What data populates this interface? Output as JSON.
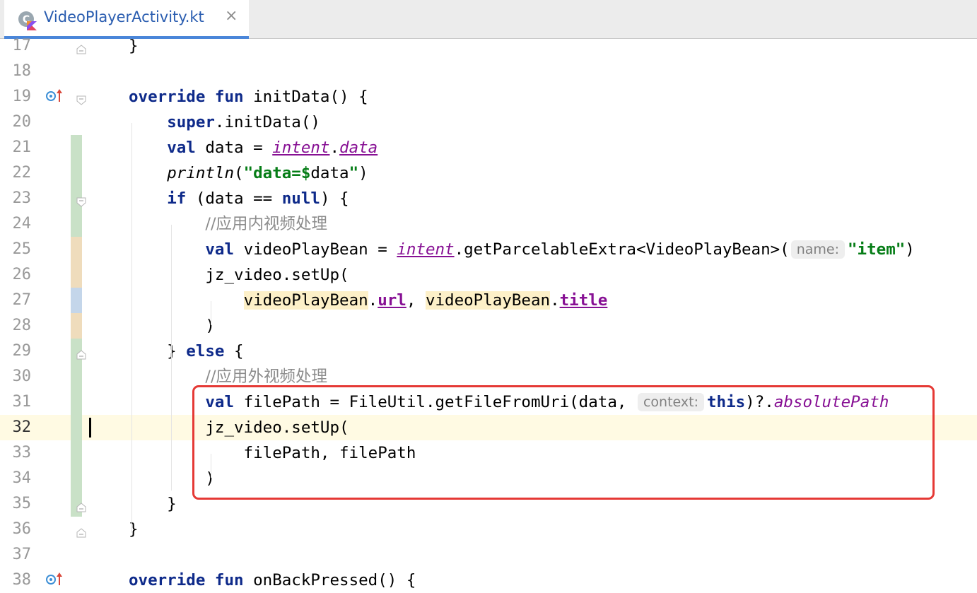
{
  "tab": {
    "title": "VideoPlayerActivity.kt",
    "close": "×",
    "icon": "kotlin-class-icon"
  },
  "editor": {
    "lines": [
      {
        "n": "17",
        "tokens": [
          [
            "",
            "}"
          ]
        ]
      },
      {
        "n": "18",
        "tokens": []
      },
      {
        "n": "19",
        "tokens": [
          [
            "kw",
            "override fun "
          ],
          [
            "",
            "initData() {"
          ]
        ]
      },
      {
        "n": "20",
        "tokens": [
          [
            "",
            "    "
          ],
          [
            "kw",
            "super"
          ],
          [
            "",
            ".initData()"
          ]
        ]
      },
      {
        "n": "21",
        "tokens": [
          [
            "",
            "    "
          ],
          [
            "kw",
            "val "
          ],
          [
            "",
            "data = "
          ],
          [
            "ital purple ul",
            "intent"
          ],
          [
            "",
            "."
          ],
          [
            "ital purple ul",
            "data"
          ]
        ]
      },
      {
        "n": "22",
        "tokens": [
          [
            "",
            "    "
          ],
          [
            "ital",
            "println"
          ],
          [
            "",
            "("
          ],
          [
            "str",
            "\"data=$"
          ],
          [
            "",
            "data"
          ],
          [
            "str",
            "\""
          ],
          [
            "",
            ")"
          ]
        ]
      },
      {
        "n": "23",
        "tokens": [
          [
            "",
            "    "
          ],
          [
            "kw",
            "if "
          ],
          [
            "",
            "(data == "
          ],
          [
            "kw",
            "null"
          ],
          [
            "",
            ") {"
          ]
        ]
      },
      {
        "n": "24",
        "tokens": [
          [
            "",
            "        "
          ],
          [
            "cmt",
            "//应用内视频处理"
          ]
        ]
      },
      {
        "n": "25",
        "tokens": [
          [
            "",
            "        "
          ],
          [
            "kw",
            "val "
          ],
          [
            "",
            "videoPlayBean = "
          ],
          [
            "ital purple ul",
            "intent"
          ],
          [
            "",
            ".getParcelableExtra<VideoPlayBean>("
          ],
          [
            "hint",
            "name:"
          ],
          [
            "str",
            "\"item\""
          ],
          [
            "",
            ")"
          ]
        ]
      },
      {
        "n": "26",
        "tokens": [
          [
            "",
            "        jz_video.setUp("
          ]
        ]
      },
      {
        "n": "27",
        "tokens": [
          [
            "",
            "            "
          ],
          [
            "hl",
            "videoPlayBean"
          ],
          [
            "",
            "."
          ],
          [
            "bold purple ul",
            "url"
          ],
          [
            "",
            ", "
          ],
          [
            "hl",
            "videoPlayBean"
          ],
          [
            "",
            "."
          ],
          [
            "bold purple ul",
            "title"
          ]
        ]
      },
      {
        "n": "28",
        "tokens": [
          [
            "",
            "        )"
          ]
        ]
      },
      {
        "n": "29",
        "tokens": [
          [
            "",
            "    } "
          ],
          [
            "kw",
            "else "
          ],
          [
            "",
            "{"
          ]
        ]
      },
      {
        "n": "30",
        "tokens": [
          [
            "",
            "        "
          ],
          [
            "cmt",
            "//应用外视频处理"
          ]
        ]
      },
      {
        "n": "31",
        "tokens": [
          [
            "",
            "        "
          ],
          [
            "kw",
            "val "
          ],
          [
            "",
            "filePath = FileUtil.getFileFromUri(data, "
          ],
          [
            "hint",
            "context:"
          ],
          [
            "kw",
            "this"
          ],
          [
            "",
            ")?."
          ],
          [
            "ital purple",
            "absolutePath"
          ]
        ]
      },
      {
        "n": "32",
        "tokens": [
          [
            "",
            "        jz_video.setUp("
          ]
        ]
      },
      {
        "n": "33",
        "tokens": [
          [
            "",
            "            filePath, filePath"
          ]
        ]
      },
      {
        "n": "34",
        "tokens": [
          [
            "",
            "        )"
          ]
        ]
      },
      {
        "n": "35",
        "tokens": [
          [
            "",
            "    }"
          ]
        ]
      },
      {
        "n": "36",
        "tokens": [
          [
            "",
            "}"
          ]
        ]
      },
      {
        "n": "37",
        "tokens": []
      },
      {
        "n": "38",
        "tokens": [
          [
            "kw",
            "override fun "
          ],
          [
            "",
            "onBackPressed() {"
          ]
        ]
      }
    ],
    "current_line": "32",
    "colors": {
      "added": "#c9e1c7",
      "modified": "#efdcbc",
      "changed_blue": "#c4d6ea",
      "keyword": "#0e2a8a",
      "string": "#067d17",
      "highlight_box": "#e53935"
    }
  }
}
